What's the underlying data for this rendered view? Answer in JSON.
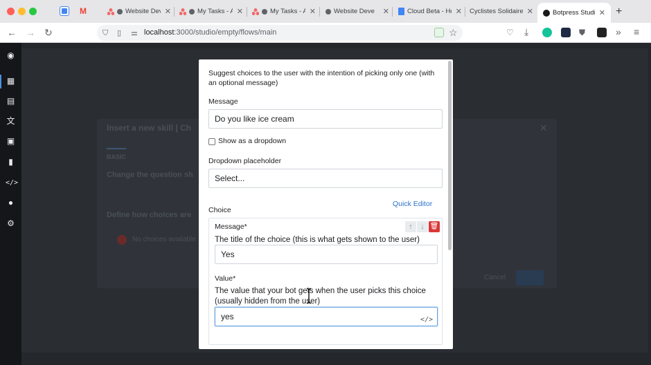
{
  "browser": {
    "tabs": [
      {
        "label": "Website Deve"
      },
      {
        "label": "My Tasks - A"
      },
      {
        "label": "My Tasks - A"
      },
      {
        "label": "Website Deve"
      },
      {
        "label": "Cloud Beta - Ho"
      },
      {
        "label": "Cyclistes Solidaires |"
      },
      {
        "label": "Botpress Studio"
      }
    ],
    "url_host": "localhost",
    "url_path": ":3000/studio/empty/flows/main"
  },
  "background": {
    "dialog_title": "Insert a new skill | Ch",
    "tab_basic": "BASIC",
    "q1": "Change the question sh",
    "q2": "Define how choices are",
    "error": "No choices available",
    "cancel": "Cancel"
  },
  "modal": {
    "description": "Suggest choices to the user with the intention of picking only one (with an optional message)",
    "message_label": "Message",
    "message_value": "Do you like ice cream",
    "dropdown_checkbox_label": "Show as a dropdown",
    "placeholder_label": "Dropdown placeholder",
    "placeholder_value": "Select...",
    "choice_label": "Choice",
    "quick_editor": "Quick Editor",
    "choice": {
      "message_label": "Message*",
      "message_help": "The title of the choice (this is what gets shown to the user)",
      "message_value": "Yes",
      "value_label": "Value*",
      "value_help": "The value that your bot gets when the user picks this choice (usually hidden from the user)",
      "value_value": "yes"
    }
  }
}
